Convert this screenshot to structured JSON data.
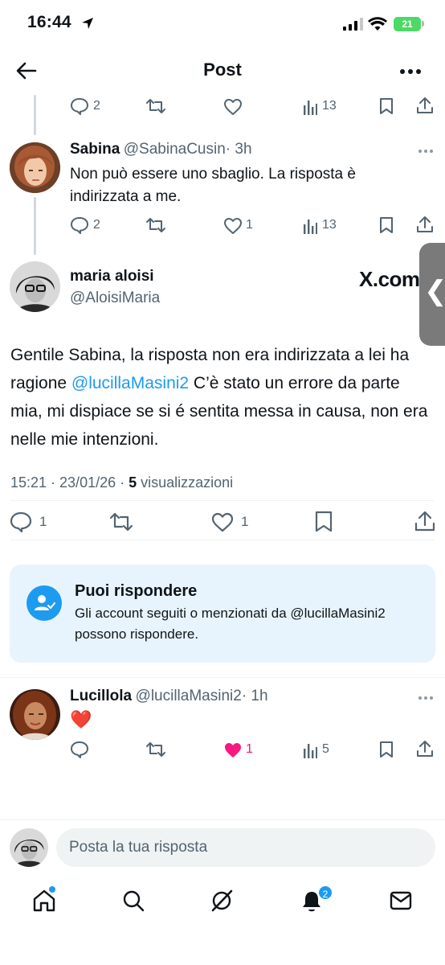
{
  "status_bar": {
    "time": "16:44",
    "battery": "21"
  },
  "header": {
    "title": "Post"
  },
  "tweets": [
    {
      "name": "",
      "handle": "",
      "text": "",
      "replies": "2",
      "reposts": "",
      "likes": "",
      "views": "13"
    },
    {
      "name": "Sabina",
      "handle": "@SabinaCusin",
      "time": "· 3h",
      "text": "Non può essere uno sbaglio. La risposta è indirizzata a me.",
      "replies": "2",
      "likes": "1",
      "views": "13"
    }
  ],
  "main_post": {
    "name": "maria aloisi",
    "handle": "@AloisiMaria",
    "watermark": "X.com",
    "text_before": "Gentile Sabina, la risposta non era indirizzata a lei ha ragione ",
    "mention": "@lucillaMasini2",
    "text_after": " C’è stato un errore da parte mia, mi dispiace se si é sentita messa in causa, non era nelle mie intenzioni.",
    "timestamp": "15:21 · 23/01/26 · ",
    "views_count": "5",
    "views_label": " visualizzazioni",
    "replies": "1",
    "likes": "1"
  },
  "reply_notice": {
    "title": "Puoi rispondere",
    "body": "Gli account seguiti o menzionati da @lucillaMasini2 possono rispondere."
  },
  "reply": {
    "name": "Lucillola",
    "handle": "@lucillaMasini2",
    "time": "· 1h",
    "text": "❤️",
    "likes": "1",
    "views": "5"
  },
  "compose": {
    "placeholder": "Posta la tua risposta"
  },
  "bottom_nav": {
    "notifications_badge": "2"
  },
  "colors": {
    "accent": "#1d9bf0",
    "like_active": "#f91880",
    "text_secondary": "#536471"
  }
}
